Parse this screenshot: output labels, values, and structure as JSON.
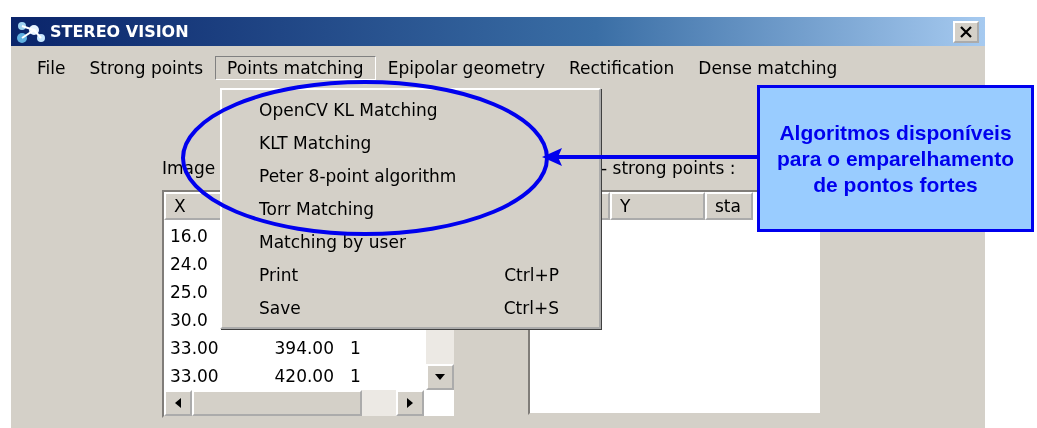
{
  "window": {
    "title": "STEREO VISION"
  },
  "menu_bar": [
    {
      "label": "File",
      "selected": false
    },
    {
      "label": "Strong points",
      "selected": false
    },
    {
      "label": "Points matching",
      "selected": true
    },
    {
      "label": "Epipolar geometry",
      "selected": false
    },
    {
      "label": "Rectification",
      "selected": false
    },
    {
      "label": "Dense matching",
      "selected": false
    }
  ],
  "dropdown": [
    {
      "label": "OpenCV KL Matching"
    },
    {
      "label": "KLT Matching"
    },
    {
      "label": "Peter 8-point algorithm"
    },
    {
      "label": "Torr Matching"
    },
    {
      "label": "Matching by user"
    },
    {
      "label": "Print",
      "shortcut": "Ctrl+P"
    },
    {
      "label": "Save",
      "shortcut": "Ctrl+S"
    }
  ],
  "left_list": {
    "label": "Image",
    "columns": [
      "X"
    ],
    "rows": [
      [
        "16.0"
      ],
      [
        "24.0"
      ],
      [
        "25.0"
      ],
      [
        "30.0"
      ],
      [
        "33.00",
        "394.00",
        "1"
      ],
      [
        "33.00",
        "420.00",
        "1"
      ]
    ]
  },
  "right_list": {
    "label": "- strong points :",
    "columns": [
      "",
      "Y",
      "sta"
    ]
  },
  "callout": {
    "text": "Algoritmos disponíveis para o emparelhamento de pontos fortes"
  }
}
